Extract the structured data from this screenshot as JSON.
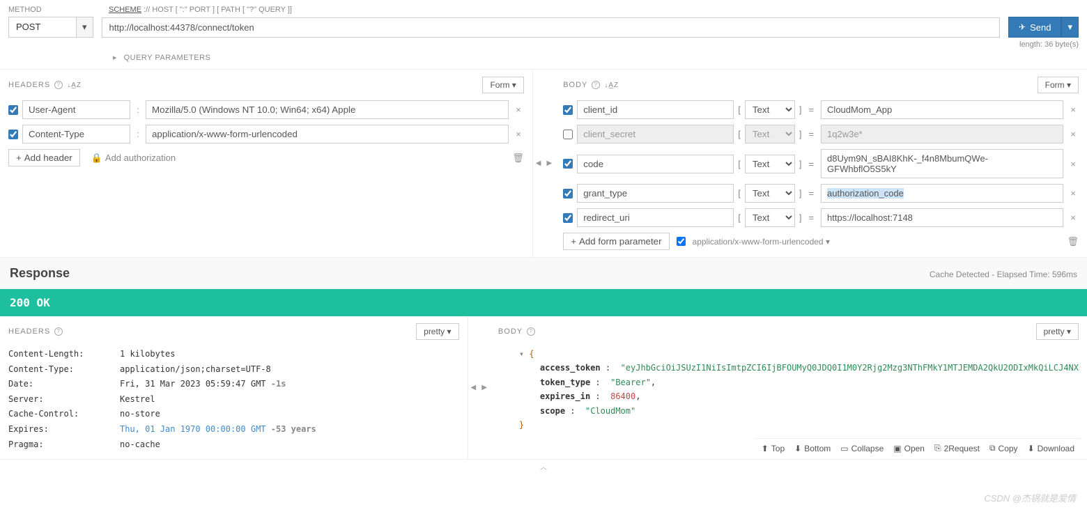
{
  "request": {
    "method_label": "METHOD",
    "scheme_label_u": "SCHEME",
    "scheme_label_rest": " :// HOST [ \":\" PORT ] [ PATH [ \"?\" QUERY ]]",
    "method": "POST",
    "url": "http://localhost:44378/connect/token",
    "send_label": "Send",
    "length_text": "length: 36 byte(s)",
    "query_params_label": "QUERY PARAMETERS"
  },
  "headers_section": {
    "title": "HEADERS",
    "form_btn": "Form ▾",
    "rows": [
      {
        "enabled": true,
        "name": "User-Agent",
        "value": "Mozilla/5.0 (Windows NT 10.0; Win64; x64) Apple"
      },
      {
        "enabled": true,
        "name": "Content-Type",
        "value": "application/x-www-form-urlencoded"
      }
    ],
    "add_header": "Add header",
    "add_auth": "Add authorization"
  },
  "body_section": {
    "title": "BODY",
    "form_btn": "Form ▾",
    "type_label": "Text",
    "rows": [
      {
        "enabled": true,
        "name": "client_id",
        "value": "CloudMom_App",
        "hl": false
      },
      {
        "enabled": false,
        "name": "client_secret",
        "value": "1q2w3e*",
        "hl": false
      },
      {
        "enabled": true,
        "name": "code",
        "value": "d8Uym9N_sBAI8KhK-_f4n8MbumQWe-GFWhbflO5S5kY",
        "hl": false
      },
      {
        "enabled": true,
        "name": "grant_type",
        "value": "authorization_code",
        "hl": true
      },
      {
        "enabled": true,
        "name": "redirect_uri",
        "value": "https://localhost:7148",
        "hl": false
      }
    ],
    "add_param": "Add form parameter",
    "encoding": "application/x-www-form-urlencoded ▾"
  },
  "response": {
    "title": "Response",
    "meta": "Cache Detected - Elapsed Time: 596ms",
    "status": "200  OK",
    "headers_title": "HEADERS",
    "pretty_btn": "pretty ▾",
    "body_title": "BODY",
    "headers": [
      {
        "k": "Content-Length:",
        "v": "1 kilobytes"
      },
      {
        "k": "Content-Type:",
        "v": "application/json;charset=UTF-8"
      },
      {
        "k": "Date:",
        "v": "Fri, 31 Mar 2023 05:59:47 GMT",
        "suffix": " -1s"
      },
      {
        "k": "Server:",
        "v": "Kestrel"
      },
      {
        "k": "Cache-Control:",
        "v": "no-store"
      },
      {
        "k": "Expires:",
        "v": "Thu, 01 Jan 1970 00:00:00 GMT",
        "suffix": " -53 years",
        "link": true
      },
      {
        "k": "Pragma:",
        "v": "no-cache"
      }
    ],
    "json": {
      "access_token": "eyJhbGciOiJSUzI1NiIsImtpZCI6IjBFOUMyQ0JDQ0I1M0Y2Rjg2Mzg3NThFMkY1MTJEMDA2QkU2ODIxMkQiLCJ4NX",
      "token_type": "Bearer",
      "expires_in": 86400,
      "scope": "CloudMom"
    },
    "toolbar": {
      "top": "Top",
      "bottom": "Bottom",
      "collapse": "Collapse",
      "open": "Open",
      "torequest": "2Request",
      "copy": "Copy",
      "download": "Download"
    }
  },
  "watermark": "CSDN @杰锅就是爱情"
}
